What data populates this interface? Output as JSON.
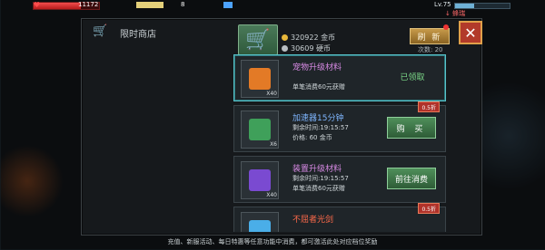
{
  "hud": {
    "hp_value": "11172",
    "hp_ratio": 0.72,
    "coins_top": "8",
    "level": "Lv.75",
    "buff": "↓ 蜂瑞"
  },
  "shop": {
    "title": "限时商店",
    "gold_amount": "320922 金币",
    "coin_amount": "30609 硬币",
    "refresh_label": "刷 新",
    "refresh_count": "次数: 20",
    "close_label": "✕"
  },
  "items": [
    {
      "name": "宠物升级材料",
      "name_color": "#d98be6",
      "line1": "",
      "line2": "单笔消费60元获赠",
      "button": "已领取",
      "button_type": "claimed",
      "multiplier": "X40",
      "icon_color": "#e37a26",
      "tag": ""
    },
    {
      "name": "加速器15分钟",
      "name_color": "#7fb6ff",
      "line1": "剩余时间:19:15:57",
      "line2": "价格: 60 金币",
      "button": "购 买",
      "button_type": "buy",
      "multiplier": "X6",
      "icon_color": "#3fa05a",
      "tag": "0.5折"
    },
    {
      "name": "装置升级材料",
      "name_color": "#d98be6",
      "line1": "剩余时间:19:15:57",
      "line2": "单笔消费60元获赠",
      "button": "前往消费",
      "button_type": "go",
      "multiplier": "X40",
      "icon_color": "#7a4ad1",
      "tag": ""
    },
    {
      "name": "不屈者光剑",
      "name_color": "#ff6a4a",
      "line1": "",
      "line2": "",
      "button": "",
      "button_type": "buy",
      "multiplier": "",
      "icon_color": "#4aaee8",
      "tag": "0.5折"
    }
  ],
  "footer": "充值、新服活动、每日特惠等任意功能中消费，都可激活此处对应档位奖励"
}
